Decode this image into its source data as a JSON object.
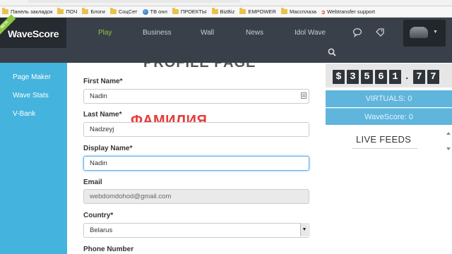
{
  "bookmarks": [
    {
      "label": "Панель закладок",
      "icon": "folder-icon"
    },
    {
      "label": "ПОЧ",
      "icon": "folder-icon"
    },
    {
      "label": "Блоги",
      "icon": "folder-icon"
    },
    {
      "label": "СоцСет",
      "icon": "folder-icon"
    },
    {
      "label": "ТВ онл",
      "icon": "globe-icon"
    },
    {
      "label": "ПРОЕКТЫ",
      "icon": "folder-icon"
    },
    {
      "label": "BizBiz",
      "icon": "folder-icon"
    },
    {
      "label": "EMPOWER",
      "icon": "folder-icon"
    },
    {
      "label": "Массплаза",
      "icon": "folder-icon"
    },
    {
      "label": "Webtransfer support",
      "icon": "link-icon"
    }
  ],
  "header": {
    "logo": "WaveScore",
    "logo_ribbon": "BETA",
    "nav": [
      "Play",
      "Business",
      "Wall",
      "News",
      "Idol Wave"
    ],
    "active_nav": "Play",
    "accent": "#8dc63f"
  },
  "sidebar": {
    "items": [
      "Page Maker",
      "Wave Stats",
      "V-Bank"
    ],
    "color": "#44b3dd"
  },
  "main": {
    "heading": "PROFILE PAGE",
    "annotation": "ФАМИЛИЯ",
    "fields": {
      "first_name": {
        "label": "First Name*",
        "value": "Nadin"
      },
      "last_name": {
        "label": "Last Name*",
        "value": "Nadzeyj"
      },
      "display_name": {
        "label": "Display Name*",
        "value": "Nadin"
      },
      "email": {
        "label": "Email",
        "value": "webdomdohod@gmail.com"
      },
      "country": {
        "label": "Country*",
        "value": "Belarus"
      },
      "phone": {
        "label": "Phone Number"
      }
    }
  },
  "right": {
    "balance_digits": [
      "$",
      "3",
      "5",
      "6",
      "1",
      ".",
      "7",
      "7"
    ],
    "virtuals": "VIRTUALS: 0",
    "wavescore": "WaveScore: 0",
    "live_feeds": "LIVE FEEDS"
  }
}
